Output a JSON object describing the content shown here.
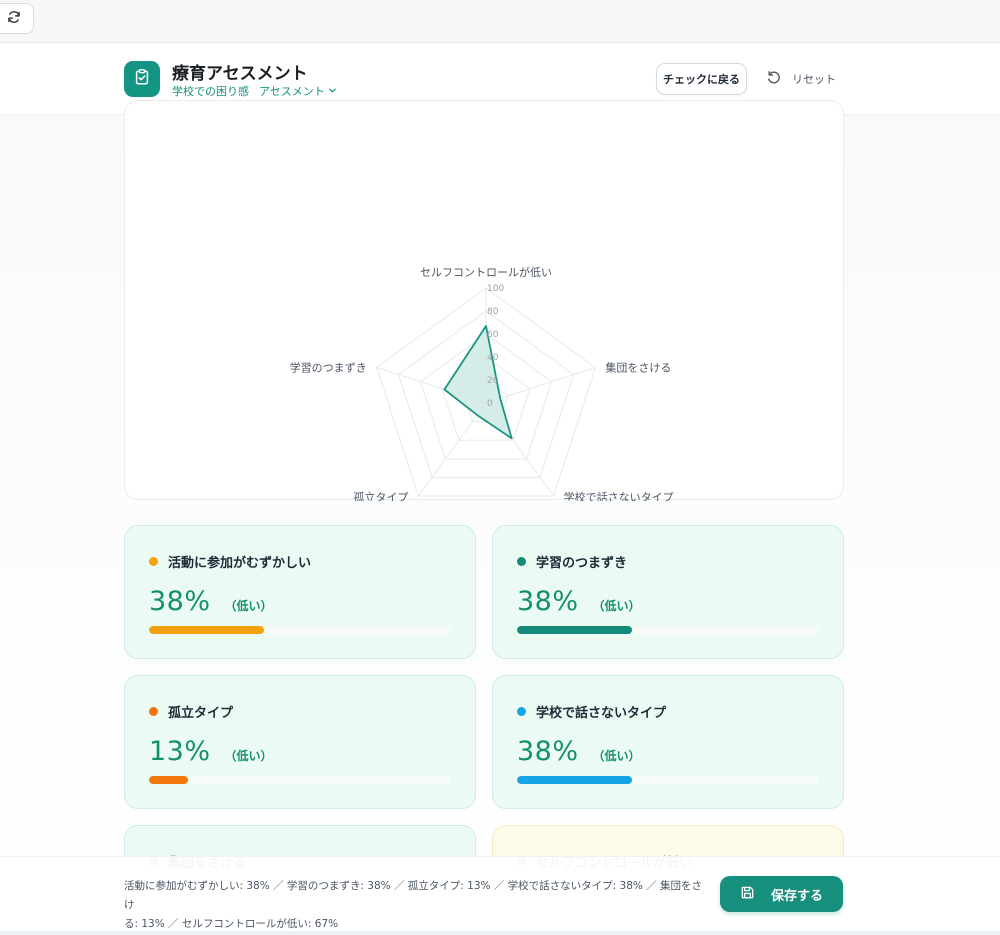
{
  "header": {
    "title": "療育アセスメント",
    "subtitle_part1": "学校での困り感",
    "subtitle_part2": "アセスメント",
    "back_label": "チェックに戻る",
    "reset_label": "リセット"
  },
  "chart_data": {
    "type": "radar",
    "axes": [
      "セルフコントロールが低い",
      "集団をさける",
      "学校で話さないタイプ",
      "孤立タイプ",
      "学習のつまずき"
    ],
    "values": [
      67,
      13,
      38,
      13,
      38
    ],
    "r_ticks": [
      0,
      20,
      40,
      60,
      80,
      100
    ],
    "r_range": [
      0,
      100
    ],
    "color": "#1a9683",
    "fill": "#cfe9e4",
    "grid": true
  },
  "metrics": [
    {
      "label": "活動に参加がむずかしい",
      "percent_text": "38%",
      "value": 38,
      "level": "（低い）",
      "color": "#f2a10c"
    },
    {
      "label": "学習のつまずき",
      "percent_text": "38%",
      "value": 38,
      "level": "（低い）",
      "color": "#148b79"
    },
    {
      "label": "孤立タイプ",
      "percent_text": "13%",
      "value": 13,
      "level": "（低い）",
      "color": "#f2760c"
    },
    {
      "label": "学校で話さないタイプ",
      "percent_text": "38%",
      "value": 38,
      "level": "（低い）",
      "color": "#15a4e4"
    },
    {
      "label": "集団をさける",
      "percent_text": "",
      "value": 13,
      "level": "",
      "color": "#6766d6"
    },
    {
      "label": "セルフコントロールが低い",
      "percent_text": "",
      "value": 67,
      "level": "",
      "color": "#e8463f"
    }
  ],
  "footer": {
    "summary_line1": "活動に参加がむずかしい: 38% ／ 学習のつまずき: 38% ／ 孤立タイプ: 13% ／ 学校で話さないタイプ: 38% ／ 集団をさけ",
    "summary_line2": "る: 13% ／ セルフコントロールが低い: 67%",
    "save_label": "保存する"
  }
}
